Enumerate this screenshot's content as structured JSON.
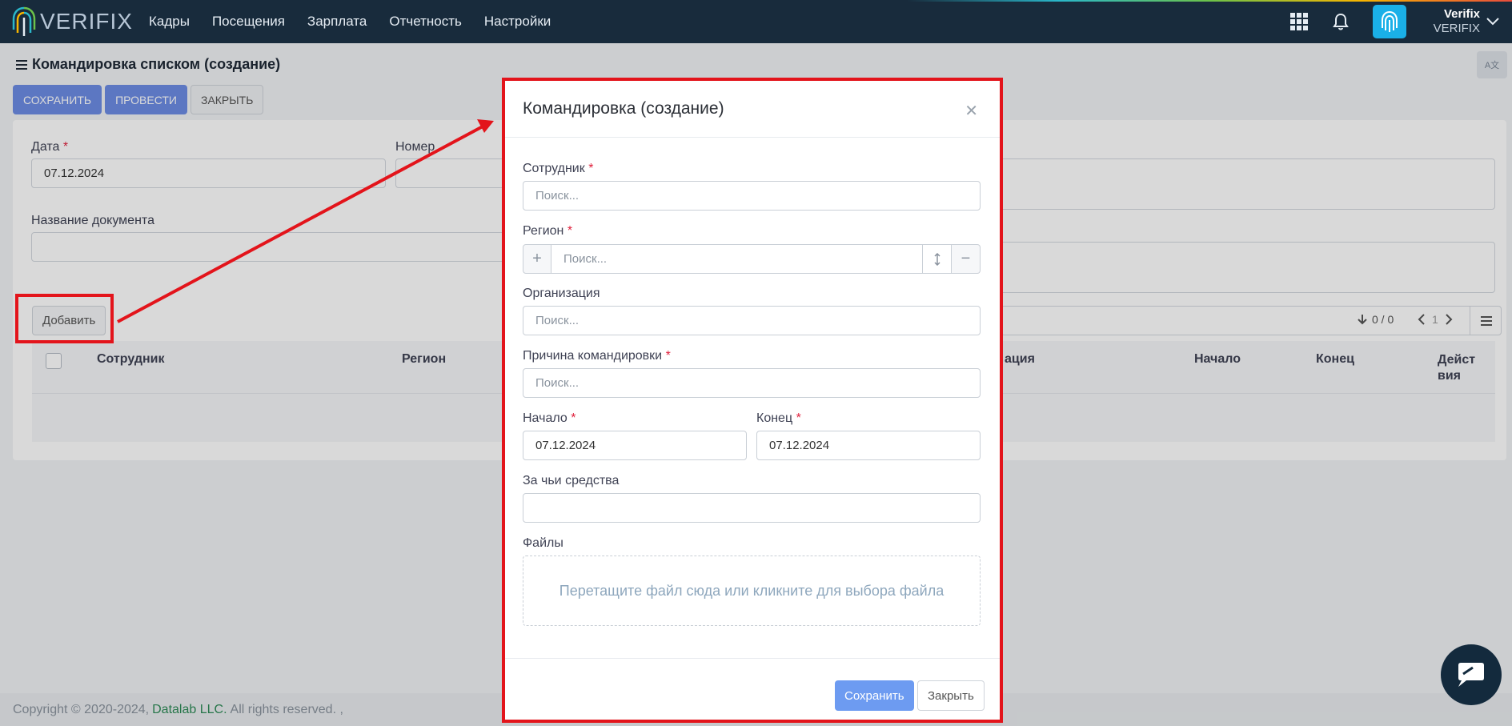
{
  "navbar": {
    "brand": "VERIFIX",
    "menu": [
      "Кадры",
      "Посещения",
      "Зарплата",
      "Отчетность",
      "Настройки"
    ],
    "user_name": "Verifix",
    "user_org": "VERIFIX"
  },
  "page": {
    "title": "Командировка списком (создание)",
    "toolbar": {
      "save": "СОХРАНИТЬ",
      "post": "ПРОВЕСТИ",
      "close": "ЗАКРЫТЬ"
    },
    "fields": {
      "date_label": "Дата",
      "date_value": "07.12.2024",
      "number_label": "Номер",
      "doc_name_label": "Название документа"
    },
    "add_button": "Добавить",
    "pager": {
      "count": "0 / 0",
      "page": "1"
    },
    "table_headers": [
      "Сотрудник",
      "Регион",
      "ация",
      "Начало",
      "Конец",
      "Дейст вия"
    ]
  },
  "modal": {
    "title": "Командировка (создание)",
    "employee_label": "Сотрудник",
    "employee_placeholder": "Поиск...",
    "region_label": "Регион",
    "region_placeholder": "Поиск...",
    "org_label": "Организация",
    "org_placeholder": "Поиск...",
    "reason_label": "Причина командировки",
    "reason_placeholder": "Поиск...",
    "start_label": "Начало",
    "start_value": "07.12.2024",
    "end_label": "Конец",
    "end_value": "07.12.2024",
    "funds_label": "За чьи средства",
    "files_label": "Файлы",
    "dropzone_text": "Перетащите файл сюда или кликните для выбора файла",
    "save_button": "Сохранить",
    "close_button": "Закрыть"
  },
  "footer": {
    "copyright": "Copyright © 2020-2024,",
    "company": "Datalab LLC.",
    "rights": "All rights reserved. ,"
  },
  "colors": {
    "annotation": "#e3141b",
    "primary": "#6d8ce4",
    "navbar": "#182b3c"
  }
}
